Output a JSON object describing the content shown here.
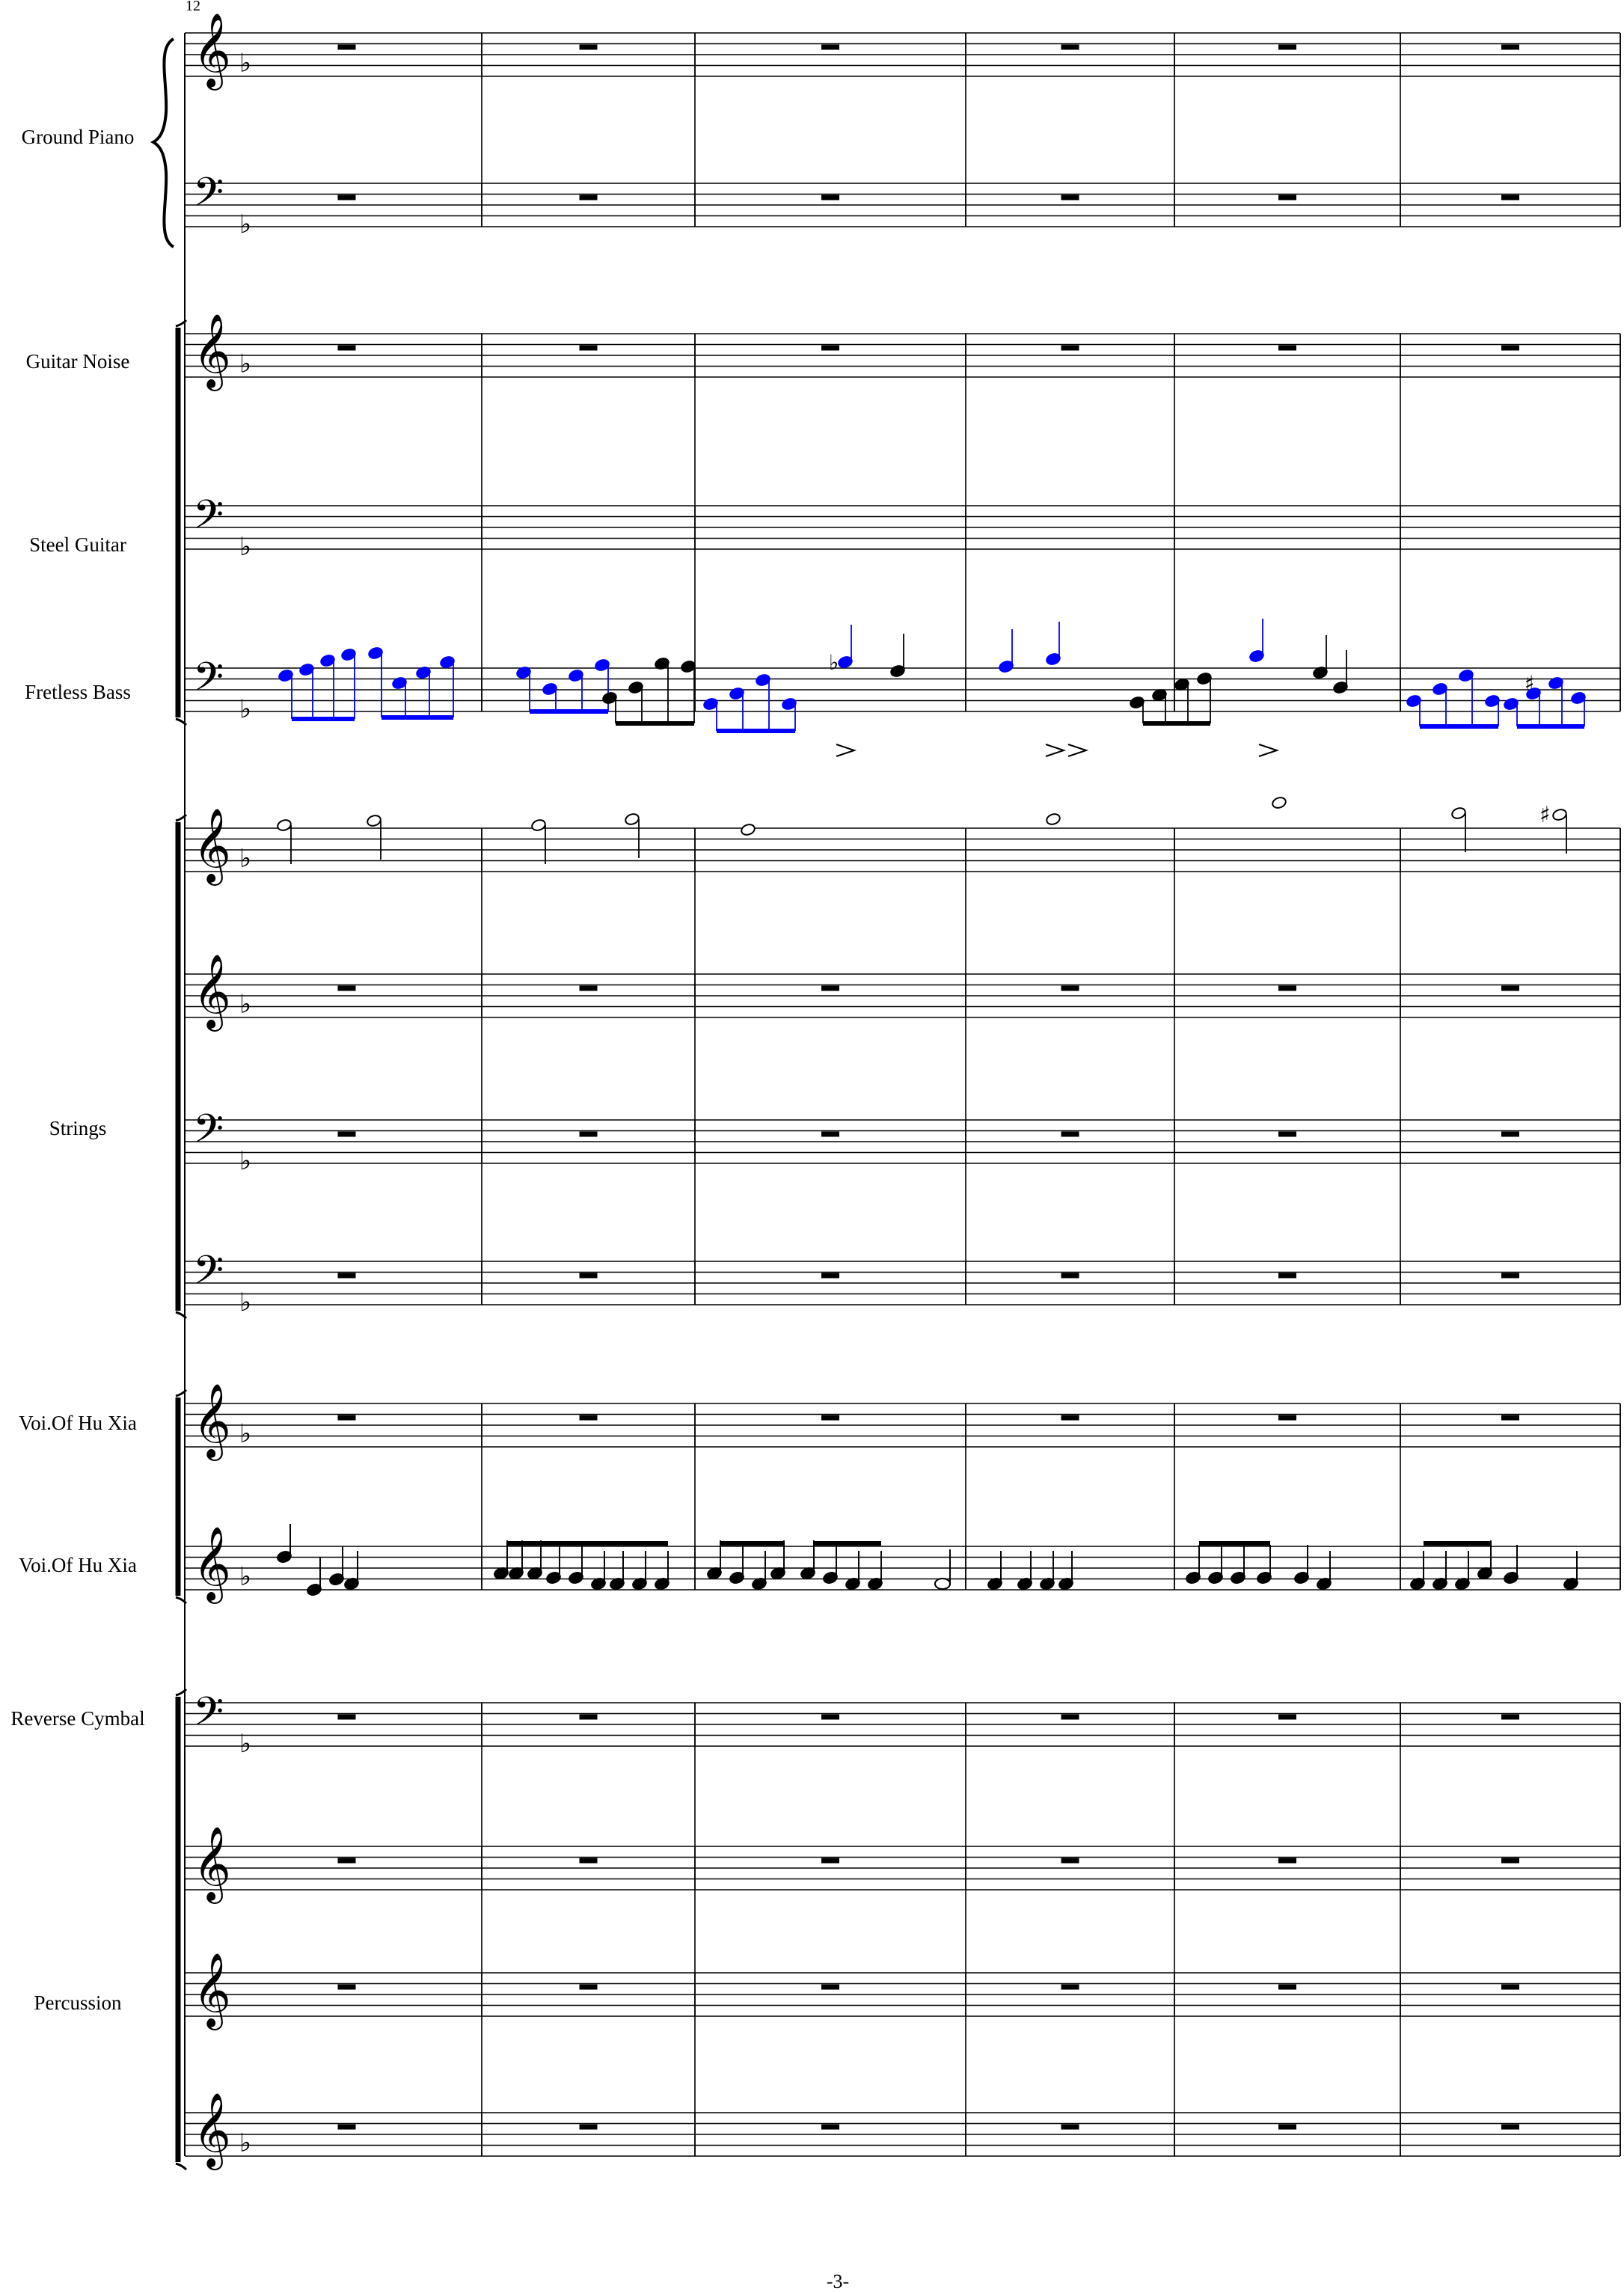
{
  "measure_number": "12",
  "page_number": "-3-",
  "colors": {
    "ink": "#000000",
    "highlight": "#0000ff"
  },
  "instruments": [
    {
      "name": "Ground Piano"
    },
    {
      "name": "Guitar Noise"
    },
    {
      "name": "Steel Guitar"
    },
    {
      "name": "Fretless Bass"
    },
    {
      "name": "Strings"
    },
    {
      "name": "Voi.Of Hu Xia"
    },
    {
      "name": "Voi.Of Hu Xia"
    },
    {
      "name": "Reverse Cymbal"
    },
    {
      "name": "Percussion"
    }
  ],
  "staves": [
    {
      "clef": "treble",
      "key": "one-flat"
    },
    {
      "clef": "bass",
      "key": "one-flat"
    },
    {
      "clef": "treble",
      "key": "one-flat"
    },
    {
      "clef": "bass",
      "key": "one-flat"
    },
    {
      "clef": "bass",
      "key": "one-flat"
    },
    {
      "clef": "treble",
      "key": "one-flat"
    },
    {
      "clef": "treble",
      "key": "one-flat"
    },
    {
      "clef": "bass",
      "key": "one-flat"
    },
    {
      "clef": "bass",
      "key": "one-flat"
    },
    {
      "clef": "treble",
      "key": "one-flat"
    },
    {
      "clef": "treble",
      "key": "one-flat"
    },
    {
      "clef": "bass",
      "key": "one-flat"
    },
    {
      "clef": "treble",
      "key": "none"
    },
    {
      "clef": "treble",
      "key": "none"
    },
    {
      "clef": "treble",
      "key": "one-flat"
    }
  ],
  "measures_per_system": 6
}
